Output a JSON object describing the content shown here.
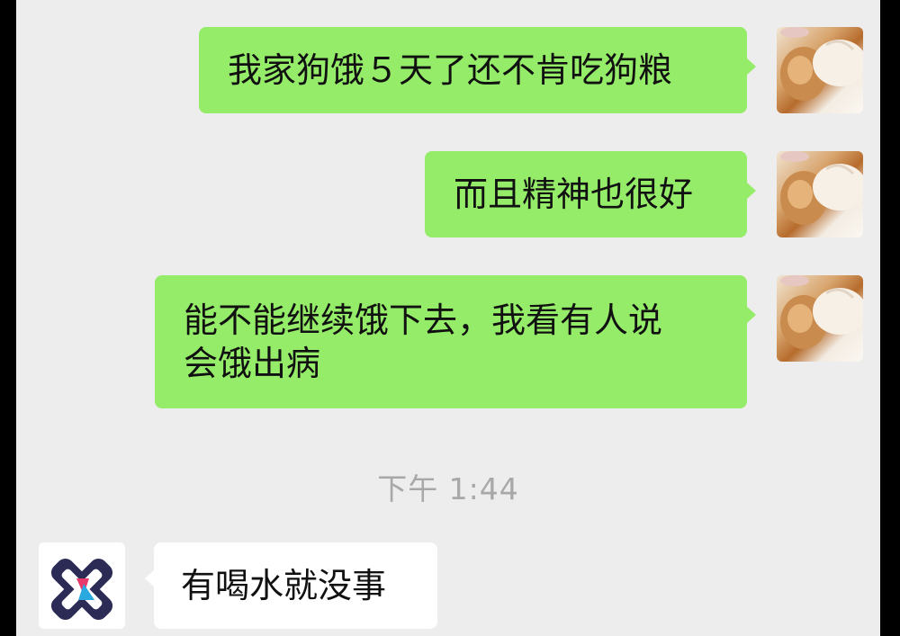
{
  "conversation": {
    "messages": [
      {
        "side": "outgoing",
        "lines": [
          "我家狗饿５天了还不肯吃狗粮"
        ]
      },
      {
        "side": "outgoing",
        "lines": [
          "而且精神也很好"
        ]
      },
      {
        "side": "outgoing",
        "lines": [
          "能不能继续饿下去，我看有人说",
          "会饿出病"
        ]
      },
      {
        "side": "incoming",
        "lines": [
          "有喝水就没事"
        ]
      }
    ],
    "timestamp": "下午 1:44"
  },
  "avatars": {
    "user": "dog-photo-avatar",
    "contact": "medical-cross-logo-avatar"
  },
  "colors": {
    "outgoing_bubble": "#95ec69",
    "incoming_bubble": "#ffffff",
    "background": "#ededed",
    "timestamp_text": "#a8a8a8"
  }
}
